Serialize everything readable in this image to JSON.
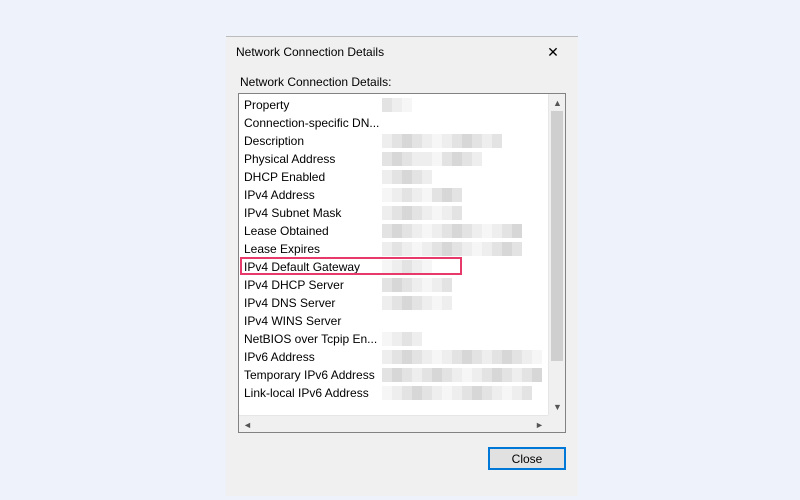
{
  "dialog": {
    "title": "Network Connection Details",
    "section_label": "Network Connection Details:",
    "close_button": "Close",
    "close_x": "✕"
  },
  "highlight": {
    "row_index": 9
  },
  "rows": [
    {
      "label": "Property"
    },
    {
      "label": "Connection-specific DN..."
    },
    {
      "label": "Description"
    },
    {
      "label": "Physical Address"
    },
    {
      "label": "DHCP Enabled"
    },
    {
      "label": "IPv4 Address"
    },
    {
      "label": "IPv4 Subnet Mask"
    },
    {
      "label": "Lease Obtained"
    },
    {
      "label": "Lease Expires"
    },
    {
      "label": "IPv4 Default Gateway"
    },
    {
      "label": "IPv4 DHCP Server"
    },
    {
      "label": "IPv4 DNS Server"
    },
    {
      "label": "IPv4 WINS Server"
    },
    {
      "label": "NetBIOS over Tcpip En..."
    },
    {
      "label": "IPv6 Address"
    },
    {
      "label": "Temporary IPv6 Address"
    },
    {
      "label": "Link-local IPv6 Address"
    }
  ]
}
